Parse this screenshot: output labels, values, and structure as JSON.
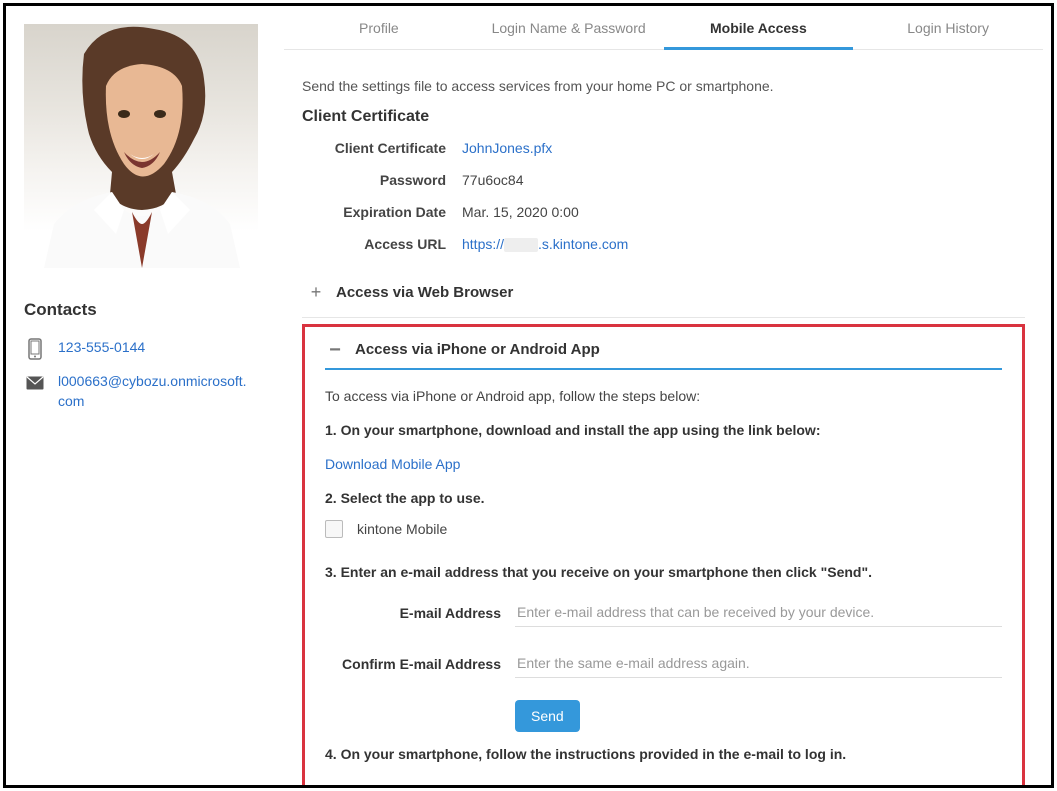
{
  "sidebar": {
    "contacts_title": "Contacts",
    "phone": "123-555-0144",
    "email": "l000663@cybozu.onmicrosoft.com"
  },
  "tabs": {
    "profile": "Profile",
    "login": "Login Name & Password",
    "mobile": "Mobile Access",
    "history": "Login History"
  },
  "intro": "Send the settings file to access services from your home PC or smartphone.",
  "cert": {
    "title": "Client Certificate",
    "label_cert": "Client Certificate",
    "value_cert": "JohnJones.pfx",
    "label_pw": "Password",
    "value_pw": "77u6oc84",
    "label_exp": "Expiration Date",
    "value_exp": "Mar. 15, 2020 0:00",
    "label_url": "Access URL",
    "url_prefix": "https://",
    "url_suffix": ".s.kintone.com"
  },
  "browser": {
    "title": "Access via Web Browser"
  },
  "app": {
    "title": "Access via iPhone or Android App",
    "intro": "To access via iPhone or Android app, follow the steps below:",
    "step1": "1. On your smartphone, download and install the app using the link below:",
    "download": "Download Mobile App",
    "step2": "2. Select the app to use.",
    "checkbox_label": "kintone Mobile",
    "step3": "3. Enter an e-mail address that you receive on your smartphone then click \"Send\".",
    "email_label": "E-mail Address",
    "email_placeholder": "Enter e-mail address that can be received by your device.",
    "confirm_label": "Confirm E-mail Address",
    "confirm_placeholder": "Enter the same e-mail address again.",
    "send": "Send",
    "step4": "4. On your smartphone, follow the instructions provided in the e-mail to log in."
  }
}
